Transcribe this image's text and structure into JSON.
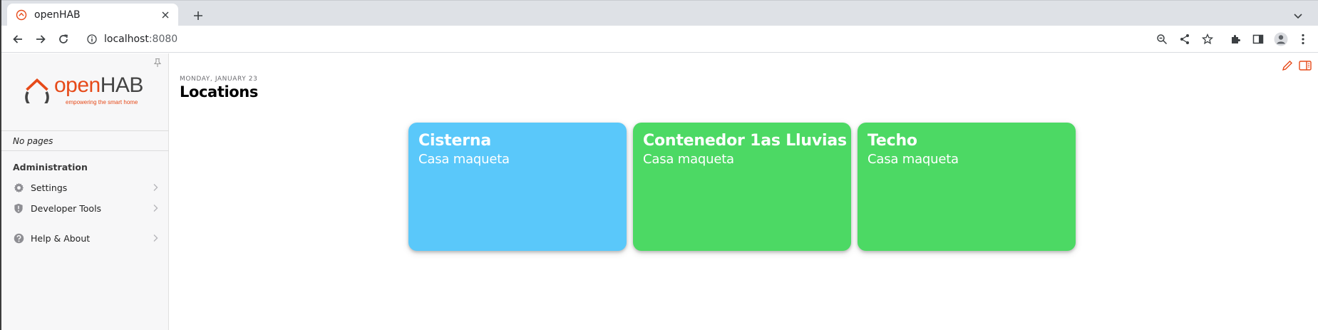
{
  "browser": {
    "tab": {
      "title": "openHAB"
    },
    "url": {
      "host": "localhost",
      "port": ":8080"
    }
  },
  "sidebar": {
    "logo": {
      "name_part1": "open",
      "name_part2": "HAB",
      "tagline": "empowering the smart home"
    },
    "no_pages": "No pages",
    "admin_title": "Administration",
    "items": [
      {
        "label": "Settings",
        "icon": "gear-icon"
      },
      {
        "label": "Developer Tools",
        "icon": "shield-icon"
      },
      {
        "label": "Help & About",
        "icon": "question-icon"
      }
    ]
  },
  "main": {
    "date": "MONDAY, JANUARY 23",
    "title": "Locations",
    "cards": [
      {
        "title": "Cisterna",
        "subtitle": "Casa maqueta",
        "color": "#5ac8fa"
      },
      {
        "title": "Contenedor 1as Lluvias",
        "subtitle": "Casa maqueta",
        "color": "#4cd964"
      },
      {
        "title": "Techo",
        "subtitle": "Casa maqueta",
        "color": "#4cd964"
      }
    ]
  },
  "colors": {
    "accent": "#e64a19",
    "blue_card": "#5ac8fa",
    "green_card": "#4cd964"
  }
}
